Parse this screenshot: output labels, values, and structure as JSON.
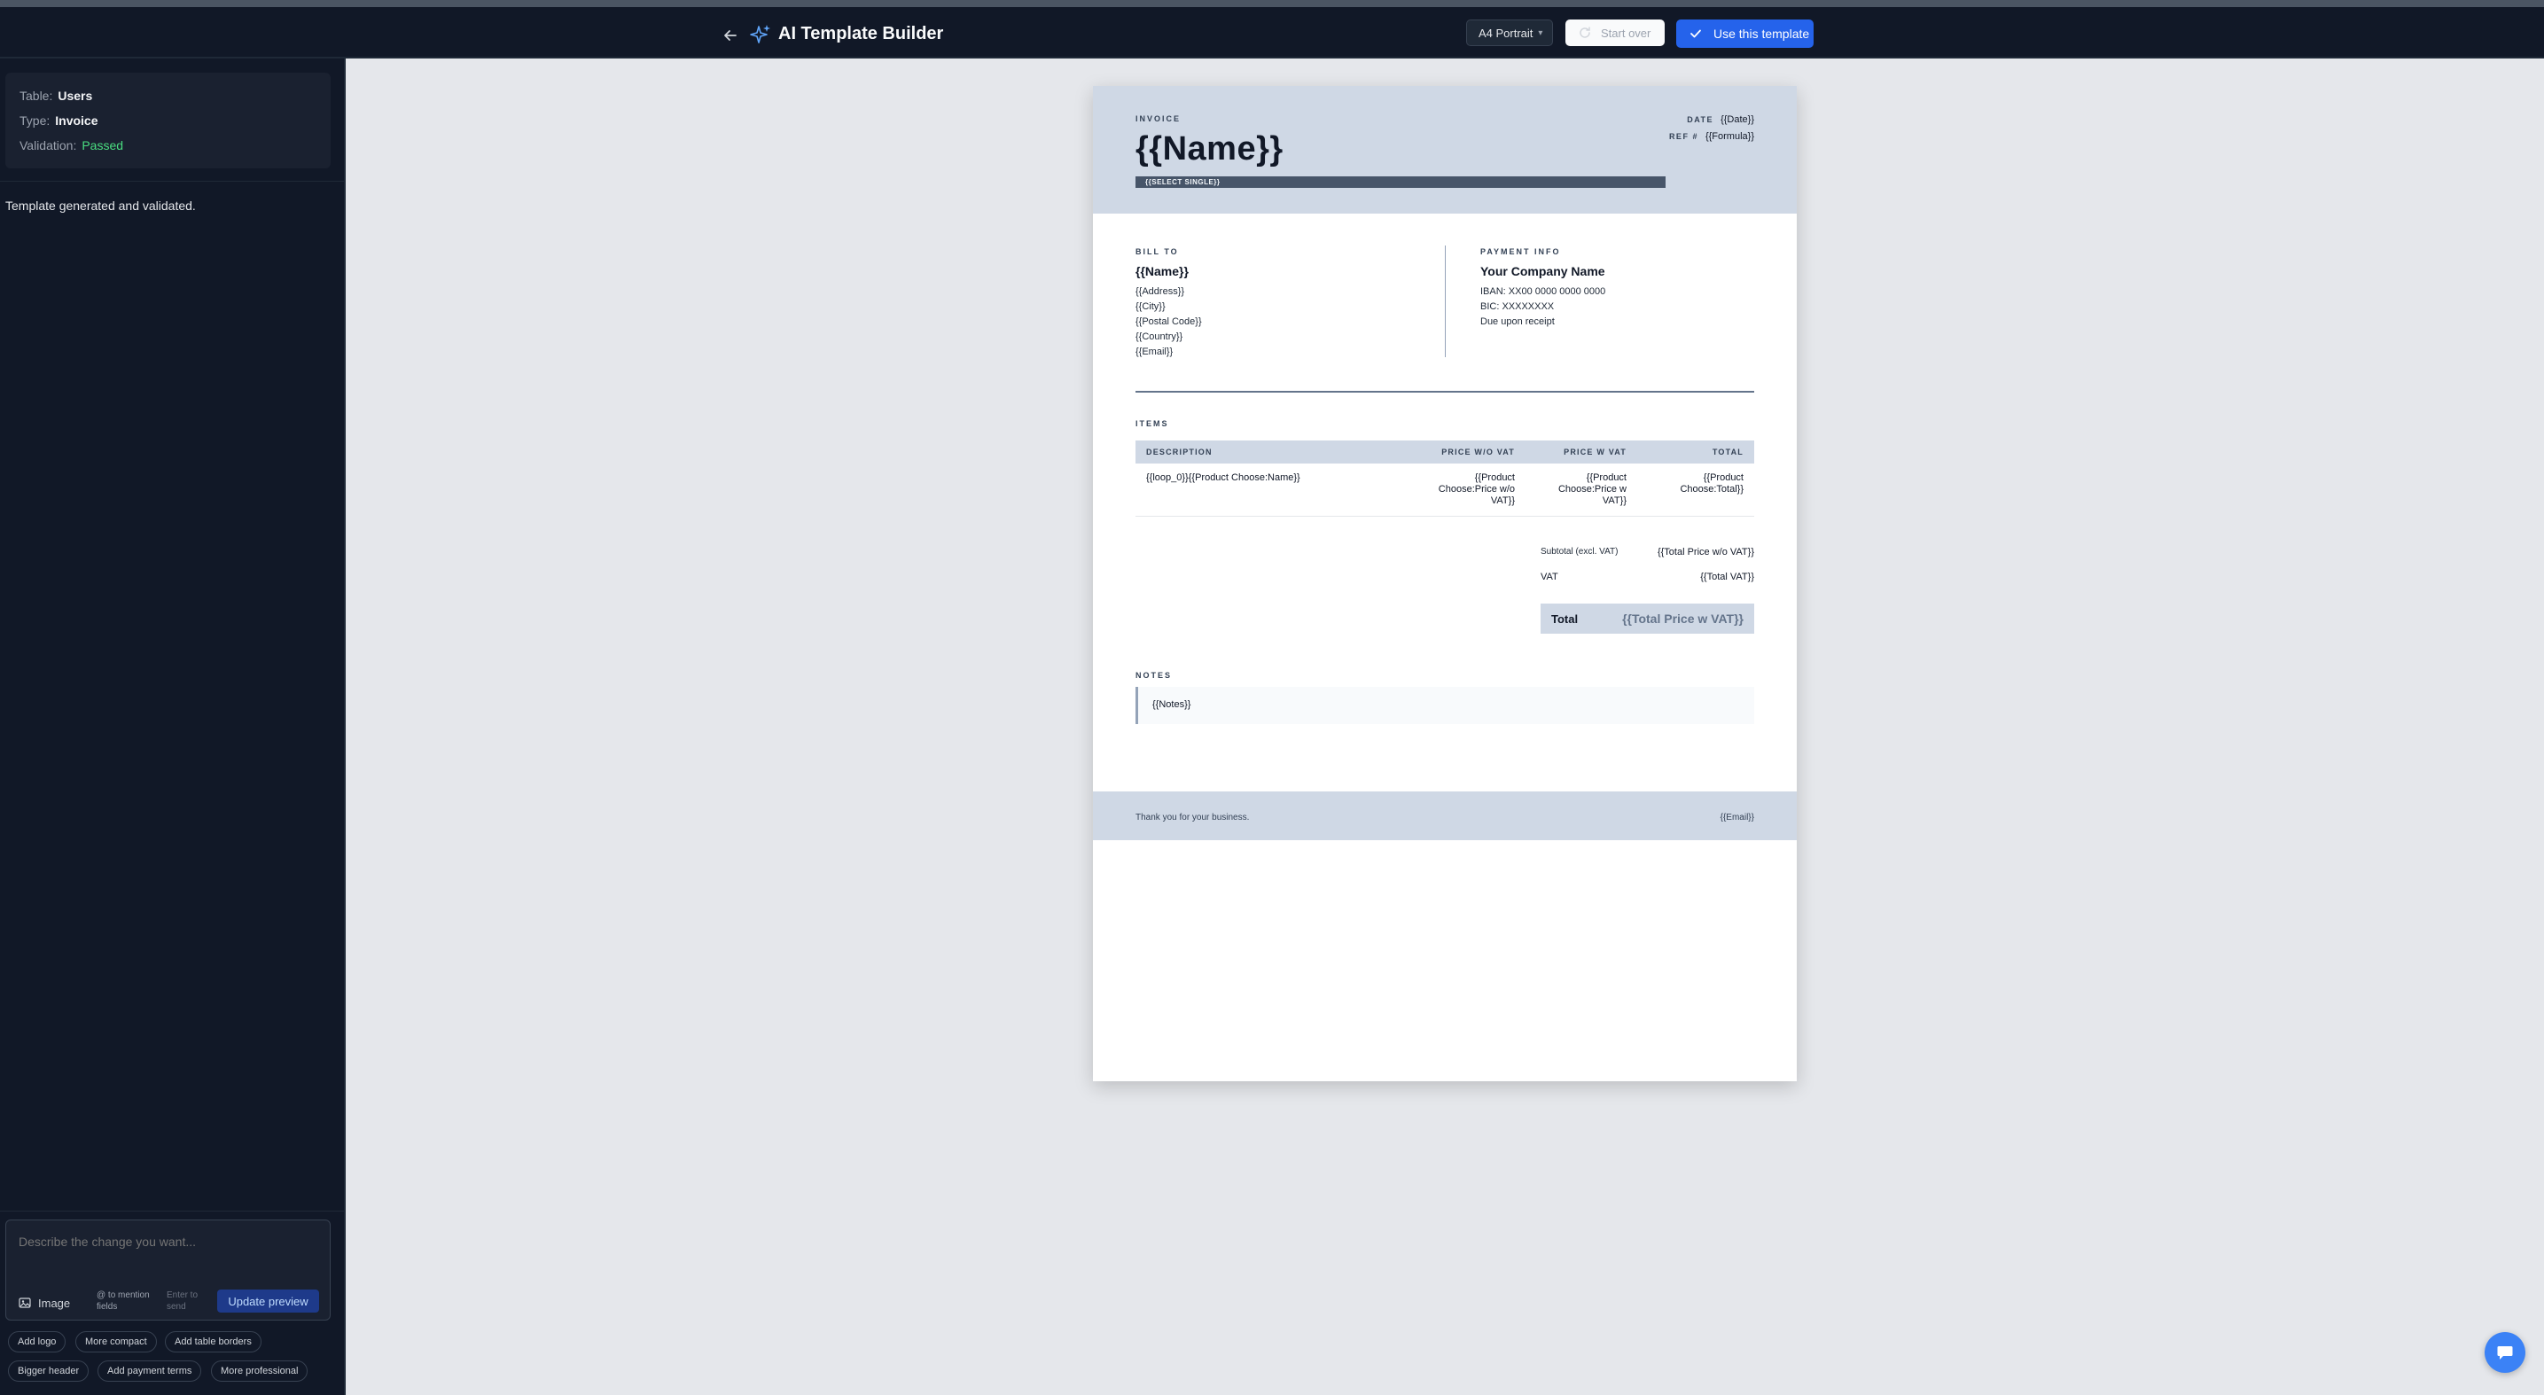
{
  "header": {
    "title": "AI Template Builder",
    "paper_format": "A4 Portrait",
    "start_over_label": "Start over",
    "use_template_label": "Use this template"
  },
  "sidebar": {
    "info": {
      "table_label": "Table:",
      "table_value": "Users",
      "type_label": "Type:",
      "type_value": "Invoice",
      "validation_label": "Validation:",
      "validation_value": "Passed"
    },
    "status_message": "Template generated and validated.",
    "composer": {
      "placeholder": "Describe the change you want...",
      "image_label": "Image",
      "mention_hint": "@ to mention fields",
      "enter_hint": "Enter to send",
      "update_label": "Update preview"
    },
    "suggestions": [
      "Add logo",
      "More compact",
      "Add table borders",
      "Bigger header",
      "Add payment terms",
      "More professional"
    ]
  },
  "invoice": {
    "kicker": "INVOICE",
    "name": "{{Name}}",
    "select_single": "{{SELECT SINGLE}}",
    "date_label": "DATE",
    "date_value": "{{Date}}",
    "ref_label": "REF #",
    "ref_value": "{{Formula}}",
    "bill_to": {
      "kicker": "BILL TO",
      "name": "{{Name}}",
      "lines": [
        "{{Address}}",
        "{{City}}",
        "{{Postal Code}}",
        "{{Country}}",
        "{{Email}}"
      ]
    },
    "payment": {
      "kicker": "PAYMENT INFO",
      "company": "Your Company Name",
      "lines": [
        "IBAN: XX00 0000 0000 0000",
        "BIC: XXXXXXXX",
        "Due upon receipt"
      ]
    },
    "items_kicker": "ITEMS",
    "columns": [
      "DESCRIPTION",
      "PRICE W/O VAT",
      "PRICE W VAT",
      "TOTAL"
    ],
    "rows": [
      [
        "{{loop_0}}{{Product Choose:Name}}",
        "{{Product Choose:Price w/o VAT}}",
        "{{Product Choose:Price w VAT}}",
        "{{Product Choose:Total}}"
      ]
    ],
    "subtotal_label": "Subtotal (excl. VAT)",
    "subtotal_value": "{{Total Price w/o VAT}}",
    "vat_label": "VAT",
    "vat_value": "{{Total VAT}}",
    "total_label": "Total",
    "total_value": "{{Total Price w VAT}}",
    "notes_kicker": "NOTES",
    "notes_value": "{{Notes}}",
    "footer_left": "Thank you for your business.",
    "footer_right": "{{Email}}"
  },
  "colors": {
    "accent": "#2563eb",
    "passed": "#4ade80",
    "invoice_band": "#cfd8e5"
  }
}
